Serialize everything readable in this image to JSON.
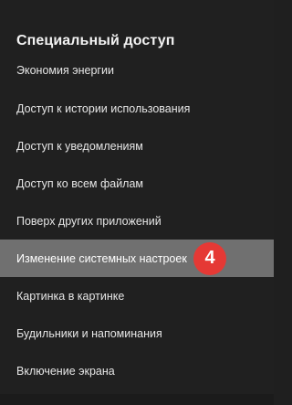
{
  "header": {
    "title": "Специальный доступ"
  },
  "menu": {
    "items": [
      {
        "label": "Экономия энергии"
      },
      {
        "label": "Доступ к истории использования"
      },
      {
        "label": "Доступ к уведомлениям"
      },
      {
        "label": "Доступ ко всем файлам"
      },
      {
        "label": "Поверх других приложений"
      },
      {
        "label": "Изменение системных настроек",
        "selected": true
      },
      {
        "label": "Картинка в картинке"
      },
      {
        "label": "Будильники и напоминания"
      },
      {
        "label": "Включение экрана"
      }
    ],
    "step_badge": "4"
  },
  "colors": {
    "background": "#202020",
    "selected_row": "#707070",
    "badge": "#e53935",
    "text": "#e6e6e6"
  }
}
